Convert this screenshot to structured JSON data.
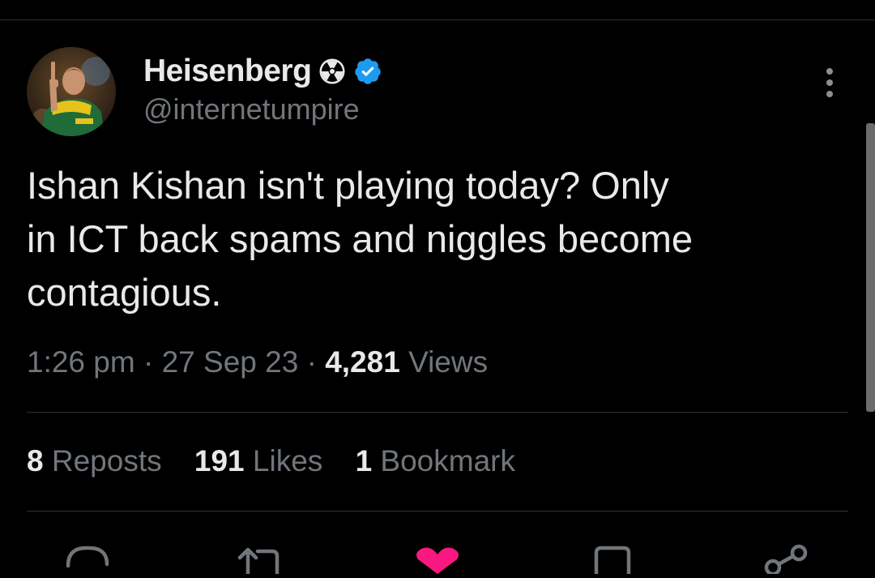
{
  "author": {
    "display_name": "Heisenberg",
    "handle": "@internetumpire",
    "avatar_icon": "avatar-photo",
    "badges": [
      "radiation-icon",
      "verified-icon"
    ],
    "verified_color": "#1d9bf0"
  },
  "tweet": {
    "text": "Ishan Kishan isn't playing today? Only\nin ICT back spams and niggles become\ncontagious."
  },
  "meta": {
    "time": "1:26 pm",
    "separator": "·",
    "date": "27 Sep 23",
    "views_count": "4,281",
    "views_label": "Views"
  },
  "stats": {
    "reposts_count": "8",
    "reposts_label": "Reposts",
    "likes_count": "191",
    "likes_label": "Likes",
    "bookmarks_count": "1",
    "bookmarks_label": "Bookmark"
  },
  "actions": [
    "reply-icon",
    "repost-icon",
    "like-icon",
    "bookmark-icon",
    "share-icon"
  ],
  "colors": {
    "background": "#000000",
    "text_primary": "#e7e9ea",
    "text_secondary": "#71767b",
    "like_active": "#f91880",
    "divider": "#2f3336"
  }
}
